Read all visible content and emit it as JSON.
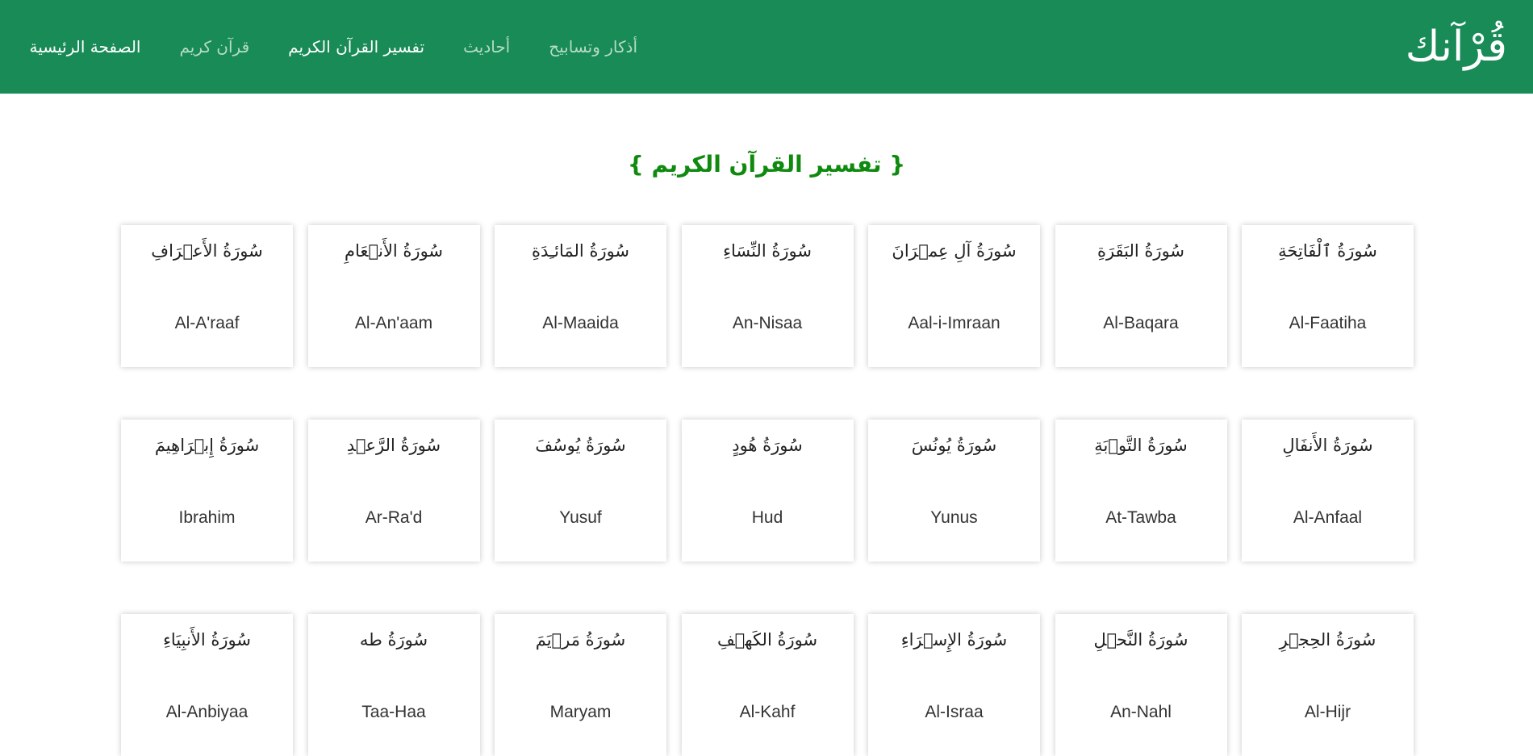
{
  "header": {
    "brand": "قُرْآنك",
    "nav": [
      {
        "label": "الصفحة الرئيسية",
        "state": "active"
      },
      {
        "label": "قرآن كريم",
        "state": "muted"
      },
      {
        "label": "تفسير القرآن الكريم",
        "state": "active"
      },
      {
        "label": "أحاديث",
        "state": "muted"
      },
      {
        "label": "أذكار وتسابيح",
        "state": "muted"
      }
    ]
  },
  "main": {
    "title": "{ تفسير القرآن الكريم }",
    "surahs": [
      {
        "ar": "سُورَةُ ٱلْفَاتِحَةِ",
        "en": "Al-Faatiha"
      },
      {
        "ar": "سُورَةُ البَقَرَةِ",
        "en": "Al-Baqara"
      },
      {
        "ar": "سُورَةُ آلِ عِمۡرَانَ",
        "en": "Aal-i-Imraan"
      },
      {
        "ar": "سُورَةُ النِّسَاءِ",
        "en": "An-Nisaa"
      },
      {
        "ar": "سُورَةُ المَائـِدَةِ",
        "en": "Al-Maaida"
      },
      {
        "ar": "سُورَةُ الأَنۡعَامِ",
        "en": "Al-An'aam"
      },
      {
        "ar": "سُورَةُ الأَعۡرَافِ",
        "en": "Al-A'raaf"
      },
      {
        "ar": "سُورَةُ الأَنفَالِ",
        "en": "Al-Anfaal"
      },
      {
        "ar": "سُورَةُ التَّوۡبَةِ",
        "en": "At-Tawba"
      },
      {
        "ar": "سُورَةُ يُونُسَ",
        "en": "Yunus"
      },
      {
        "ar": "سُورَةُ هُودٍ",
        "en": "Hud"
      },
      {
        "ar": "سُورَةُ يُوسُفَ",
        "en": "Yusuf"
      },
      {
        "ar": "سُورَةُ الرَّعۡدِ",
        "en": "Ar-Ra'd"
      },
      {
        "ar": "سُورَةُ إِبۡرَاهِيمَ",
        "en": "Ibrahim"
      },
      {
        "ar": "سُورَةُ الحِجۡرِ",
        "en": "Al-Hijr"
      },
      {
        "ar": "سُورَةُ النَّحۡلِ",
        "en": "An-Nahl"
      },
      {
        "ar": "سُورَةُ الإِسۡرَاءِ",
        "en": "Al-Israa"
      },
      {
        "ar": "سُورَةُ الكَهۡفِ",
        "en": "Al-Kahf"
      },
      {
        "ar": "سُورَةُ مَرۡيَمَ",
        "en": "Maryam"
      },
      {
        "ar": "سُورَةُ طه",
        "en": "Taa-Haa"
      },
      {
        "ar": "سُورَةُ الأَنبِيَاءِ",
        "en": "Al-Anbiyaa"
      }
    ]
  }
}
